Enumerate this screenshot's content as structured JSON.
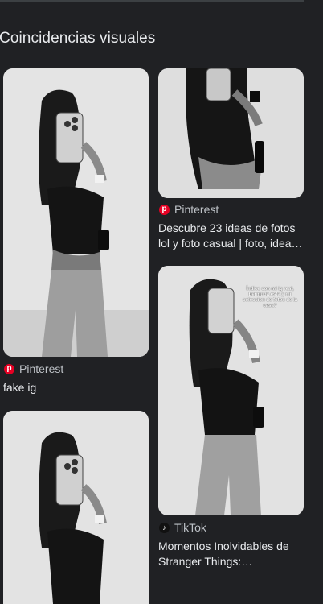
{
  "section": {
    "title": "Coincidencias visuales"
  },
  "results": [
    {
      "source": "Pinterest",
      "source_icon": "pinterest-icon",
      "caption": "fake ig"
    },
    {
      "source": "Pinterest",
      "source_icon": "pinterest-icon",
      "caption": "Descubre 23 ideas de fotos lol y foto casual | foto, idea…"
    },
    {
      "source": "TikTok",
      "source_icon": "tiktok-icon",
      "caption": "Momentos Inolvidables de Stranger Things:…",
      "overlay_text": "Índice con mi ig real, bermuda esta y mi coleccion de fotos de la casa?"
    },
    {
      "source": "",
      "caption": ""
    }
  ],
  "colors": {
    "background": "#202124",
    "pinterest": "#e60023",
    "tiktok": "#111111"
  }
}
